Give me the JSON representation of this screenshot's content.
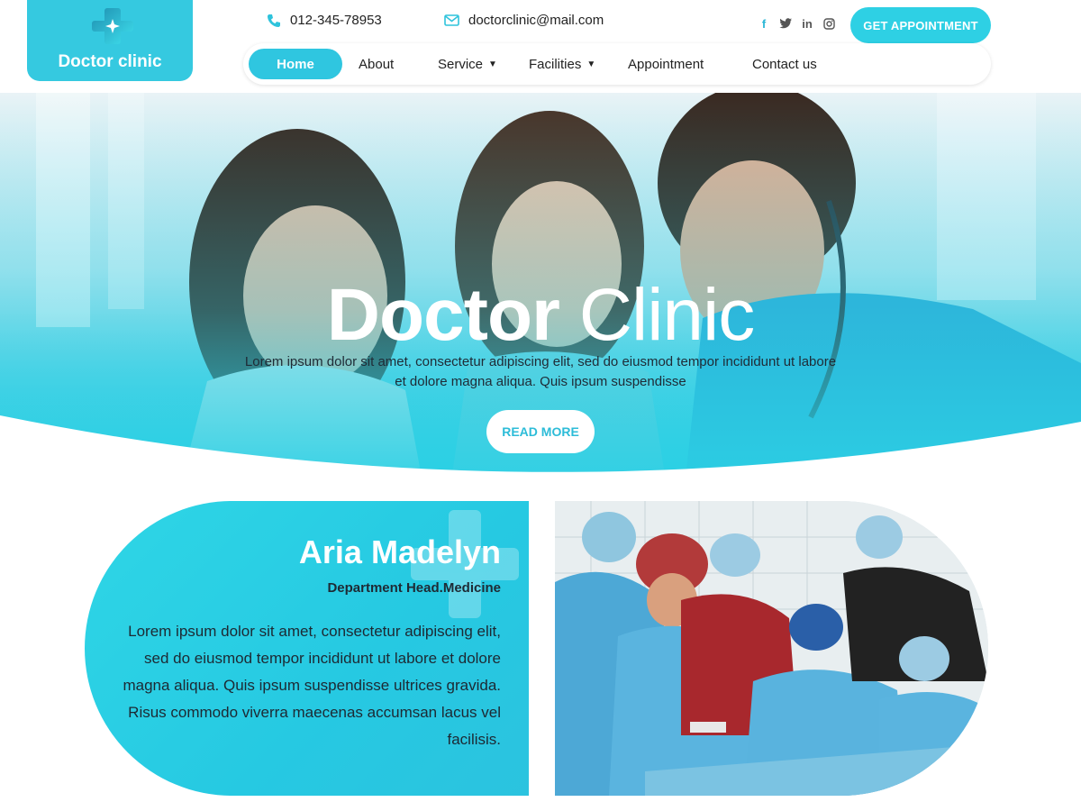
{
  "header": {
    "logo_text": "Doctor clinic",
    "phone": "012-345-78953",
    "email": "doctorclinic@mail.com",
    "socials": [
      "facebook-icon",
      "twitter-icon",
      "linkedin-icon",
      "instagram-icon"
    ],
    "appointment_button": "GET APPOINTMENT"
  },
  "nav": {
    "items": [
      {
        "label": "Home",
        "active": true
      },
      {
        "label": "About"
      },
      {
        "label": "Service",
        "dropdown": true
      },
      {
        "label": "Facilities",
        "dropdown": true
      },
      {
        "label": "Appointment"
      },
      {
        "label": "Contact us"
      }
    ]
  },
  "hero": {
    "title_bold": "Doctor",
    "title_light": "Clinic",
    "description": "Lorem ipsum dolor sit amet, consectetur adipiscing elit, sed do eiusmod tempor incididunt ut labore et dolore magna aliqua. Quis ipsum suspendisse",
    "button": "READ MORE"
  },
  "doctor": {
    "name": "Aria Madelyn",
    "role": "Department Head.Medicine",
    "bio": "Lorem ipsum dolor sit amet, consectetur adipiscing elit, sed do eiusmod tempor incididunt ut labore et dolore magna aliqua. Quis ipsum suspendisse ultrices gravida. Risus commodo viverra maecenas accumsan lacus vel facilisis."
  },
  "colors": {
    "accent": "#2ed0e4",
    "accent_dark": "#26c3de",
    "text": "#1d2933"
  }
}
